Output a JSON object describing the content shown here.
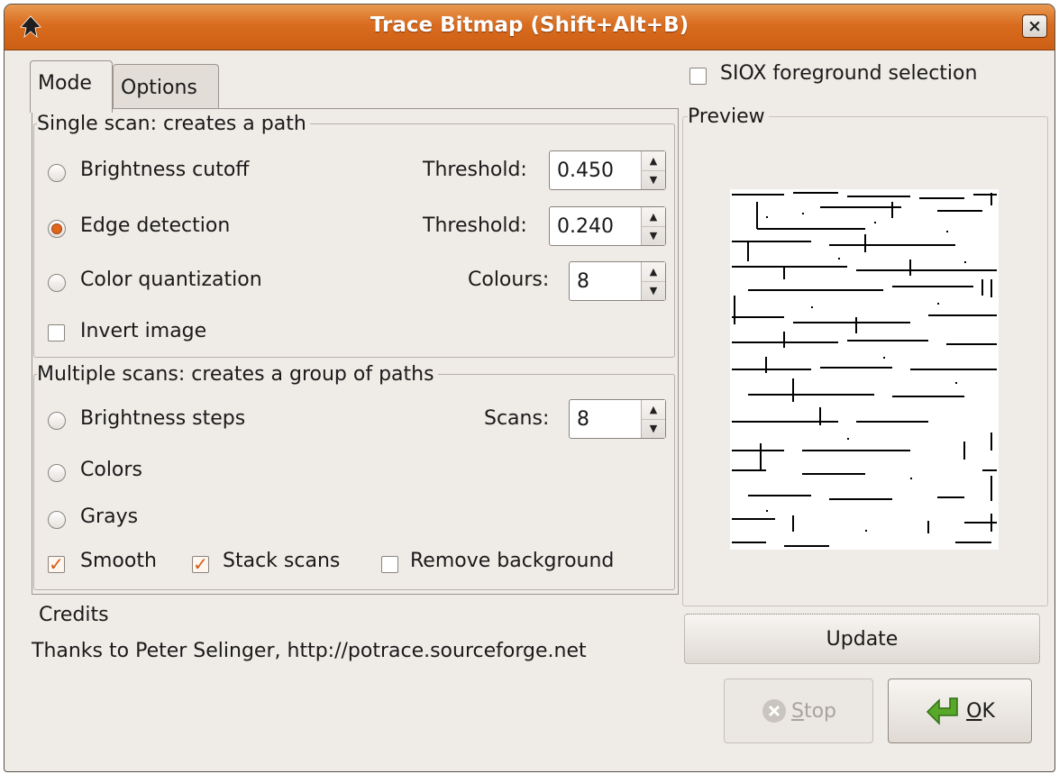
{
  "window": {
    "title": "Trace Bitmap (Shift+Alt+B)",
    "close_glyph": "×"
  },
  "tabs": [
    {
      "label": "Mode",
      "active": true
    },
    {
      "label": "Options",
      "active": false
    }
  ],
  "single_scan": {
    "legend": "Single scan: creates a path",
    "brightness": {
      "label": "Brightness cutoff",
      "selected": false,
      "param_label": "Threshold:",
      "value": "0.450"
    },
    "edge": {
      "label": "Edge detection",
      "selected": true,
      "param_label": "Threshold:",
      "value": "0.240"
    },
    "color_quant": {
      "label": "Color quantization",
      "selected": false,
      "param_label": "Colours:",
      "value": "8"
    },
    "invert": {
      "label": "Invert image",
      "checked": false
    }
  },
  "multi_scan": {
    "legend": "Multiple scans: creates a group of paths",
    "brightness_steps": {
      "label": "Brightness steps",
      "selected": false,
      "param_label": "Scans:",
      "value": "8"
    },
    "colors": {
      "label": "Colors",
      "selected": false
    },
    "grays": {
      "label": "Grays",
      "selected": false
    },
    "smooth": {
      "label": "Smooth",
      "checked": true
    },
    "stack": {
      "label": "Stack scans",
      "checked": true
    },
    "remove_bg": {
      "label": "Remove background",
      "checked": false
    }
  },
  "credits": {
    "heading": "Credits",
    "text": "Thanks to Peter Selinger, http://potrace.sourceforge.net"
  },
  "siox": {
    "label": "SIOX foreground selection",
    "checked": false
  },
  "preview": {
    "label": "Preview"
  },
  "buttons": {
    "update": "Update",
    "stop": "Stop",
    "stop_mnemonic": "S",
    "stop_rest": "top",
    "ok": "OK",
    "ok_mnemonic": "O",
    "ok_rest": "K"
  },
  "icons": {
    "app": "inkscape-icon",
    "stop": "stop-icon",
    "ok": "ok-arrow-icon"
  },
  "colors": {
    "titlebar": "#d96c1e",
    "accent": "#e0661c",
    "ok_icon": "#5aa82a",
    "window_bg": "#efebe7"
  }
}
